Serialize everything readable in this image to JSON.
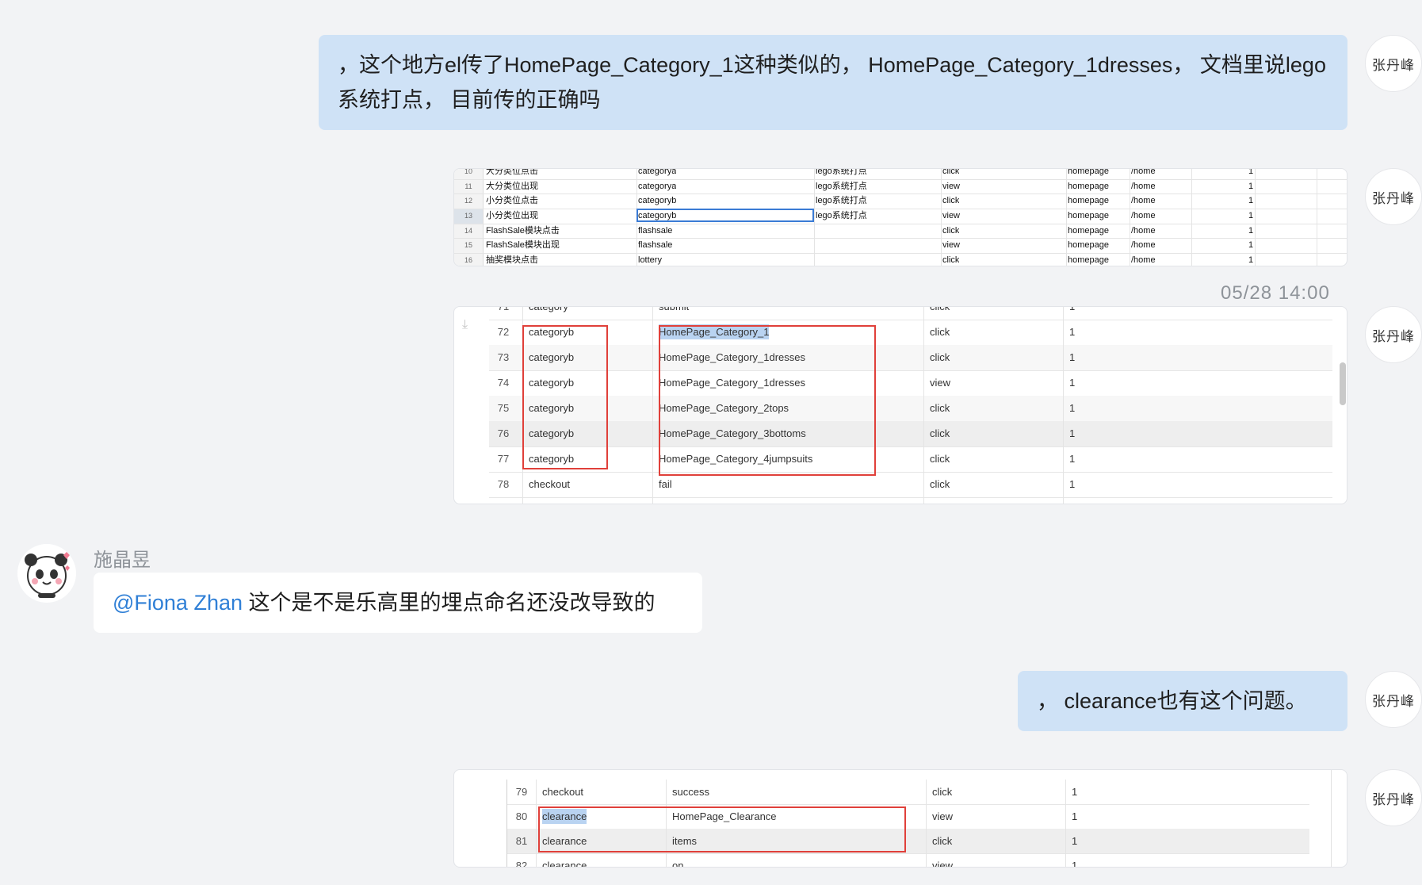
{
  "messages": {
    "msg1": {
      "text": "，这个地方el传了HomePage_Category_1这种类似的， HomePage_Category_1dresses， 文档里说lego系统打点， 目前传的正确吗"
    },
    "msg2": {
      "text": "， clearance也有这个问题。"
    },
    "msg_other": {
      "sender": "施晶昱",
      "mention": "@Fiona Zhan",
      "text": " 这个是不是乐高里的埋点命名还没改导致的"
    }
  },
  "me": {
    "avatar_name": "张丹峰"
  },
  "timestamp": "05/28 14:00",
  "sheet1": {
    "rows": [
      {
        "n": "10",
        "name": "大分类位点击",
        "id": "categorya",
        "sys": "lego系统打点",
        "act": "click",
        "page": "homepage",
        "path": "/home",
        "v": "1"
      },
      {
        "n": "11",
        "name": "大分类位出现",
        "id": "categorya",
        "sys": "lego系统打点",
        "act": "view",
        "page": "homepage",
        "path": "/home",
        "v": "1"
      },
      {
        "n": "12",
        "name": "小分类位点击",
        "id": "categoryb",
        "sys": "lego系统打点",
        "act": "click",
        "page": "homepage",
        "path": "/home",
        "v": "1"
      },
      {
        "n": "13",
        "name": "小分类位出现",
        "id": "categoryb",
        "sys": "lego系统打点",
        "act": "view",
        "page": "homepage",
        "path": "/home",
        "v": "1"
      },
      {
        "n": "14",
        "name": "FlashSale模块点击",
        "id": "flashsale",
        "sys": "",
        "act": "click",
        "page": "homepage",
        "path": "/home",
        "v": "1"
      },
      {
        "n": "15",
        "name": "FlashSale模块出现",
        "id": "flashsale",
        "sys": "",
        "act": "view",
        "page": "homepage",
        "path": "/home",
        "v": "1"
      },
      {
        "n": "16",
        "name": "抽奖模块点击",
        "id": "lottery",
        "sys": "",
        "act": "click",
        "page": "homepage",
        "path": "/home",
        "v": "1"
      }
    ]
  },
  "table2": {
    "rows": [
      {
        "n": "71",
        "a": "category",
        "b": "submit",
        "c": "click",
        "d": "1"
      },
      {
        "n": "72",
        "a": "categoryb",
        "b": "HomePage_Category_1",
        "c": "click",
        "d": "1"
      },
      {
        "n": "73",
        "a": "categoryb",
        "b": "HomePage_Category_1dresses",
        "c": "click",
        "d": "1"
      },
      {
        "n": "74",
        "a": "categoryb",
        "b": "HomePage_Category_1dresses",
        "c": "view",
        "d": "1"
      },
      {
        "n": "75",
        "a": "categoryb",
        "b": "HomePage_Category_2tops",
        "c": "click",
        "d": "1"
      },
      {
        "n": "76",
        "a": "categoryb",
        "b": "HomePage_Category_3bottoms",
        "c": "click",
        "d": "1"
      },
      {
        "n": "77",
        "a": "categoryb",
        "b": "HomePage_Category_4jumpsuits",
        "c": "click",
        "d": "1"
      },
      {
        "n": "78",
        "a": "checkout",
        "b": "fail",
        "c": "click",
        "d": "1"
      }
    ]
  },
  "table3": {
    "rows": [
      {
        "n": "79",
        "a": "checkout",
        "b": "success",
        "c": "click",
        "d": "1"
      },
      {
        "n": "80",
        "a": "clearance",
        "b": "HomePage_Clearance",
        "c": "view",
        "d": "1"
      },
      {
        "n": "81",
        "a": "clearance",
        "b": "items",
        "c": "click",
        "d": "1"
      },
      {
        "n": "82",
        "a": "clearance",
        "b": "on",
        "c": "view",
        "d": "1"
      }
    ]
  },
  "colors": {
    "my_bubble": "#cfe2f6",
    "other_bubble": "#ffffff",
    "mention": "#2f7fd6",
    "annotation_box": "#e0403a",
    "background": "#f2f3f5"
  }
}
